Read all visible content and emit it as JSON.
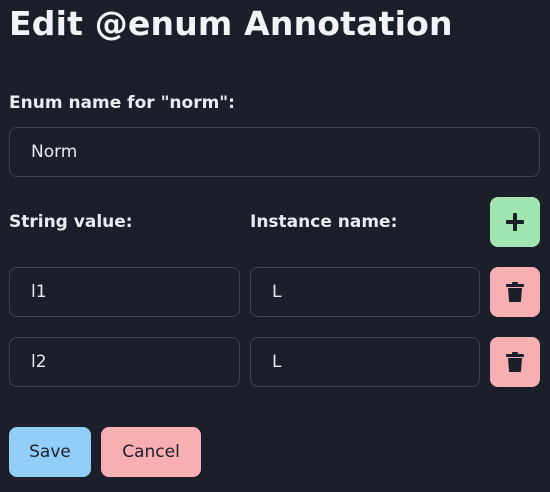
{
  "dialog": {
    "title": "Edit @enum Annotation",
    "enum_name_label": "Enum name for \"norm\":",
    "enum_name_value": "Norm",
    "string_value_header": "String value:",
    "instance_name_header": "Instance name:",
    "rows": [
      {
        "string_value": "l1",
        "instance_name": "L"
      },
      {
        "string_value": "l2",
        "instance_name": "L"
      }
    ],
    "save_label": "Save",
    "cancel_label": "Cancel"
  },
  "icons": {
    "add": "plus-icon",
    "delete": "trash-icon"
  },
  "colors": {
    "background": "#1b1f2a",
    "add_button": "#a1e6b0",
    "delete_button": "#f8afb1",
    "save_button": "#92cdf7",
    "cancel_button": "#f8afb1"
  }
}
